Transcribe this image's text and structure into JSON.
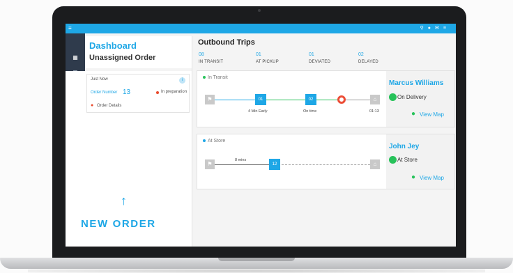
{
  "app": {
    "menu_icon": "hamburger-menu-icon",
    "toolbar_icons": [
      "search-icon",
      "user-icon",
      "mail-icon",
      "settings-icon"
    ],
    "accent_color": "#1ea7e6",
    "sidebar_color": "#2f3b4c"
  },
  "left_panel": {
    "title": "Dashboard",
    "subtitle": "Unassigned Order",
    "order_card": {
      "time": "Just Now",
      "order_number_label": "Order Number",
      "order_number": "13",
      "status": "In preparation",
      "details_link": "Order Details"
    },
    "new_order_label": "NEW ORDER"
  },
  "outbound": {
    "title": "Outbound Trips",
    "stats": [
      {
        "count": "08",
        "label": "IN TRANSIT"
      },
      {
        "count": "01",
        "label": "AT PICKUP"
      },
      {
        "count": "01",
        "label": "DEVIATED"
      },
      {
        "count": "02",
        "label": "DELAYED"
      }
    ],
    "trips": [
      {
        "status": "In Transit",
        "stops": [
          "01",
          "02"
        ],
        "labels": [
          "4 Min Early",
          "On time",
          "01:13"
        ],
        "driver": "Marcus Williams",
        "driver_status": "On Delivery",
        "map_link": "View Map"
      },
      {
        "status": "At Store",
        "stops": [
          "12"
        ],
        "labels": [
          "8 mins"
        ],
        "driver": "John Jey",
        "driver_status": "At Store",
        "map_link": "View Map"
      }
    ]
  }
}
